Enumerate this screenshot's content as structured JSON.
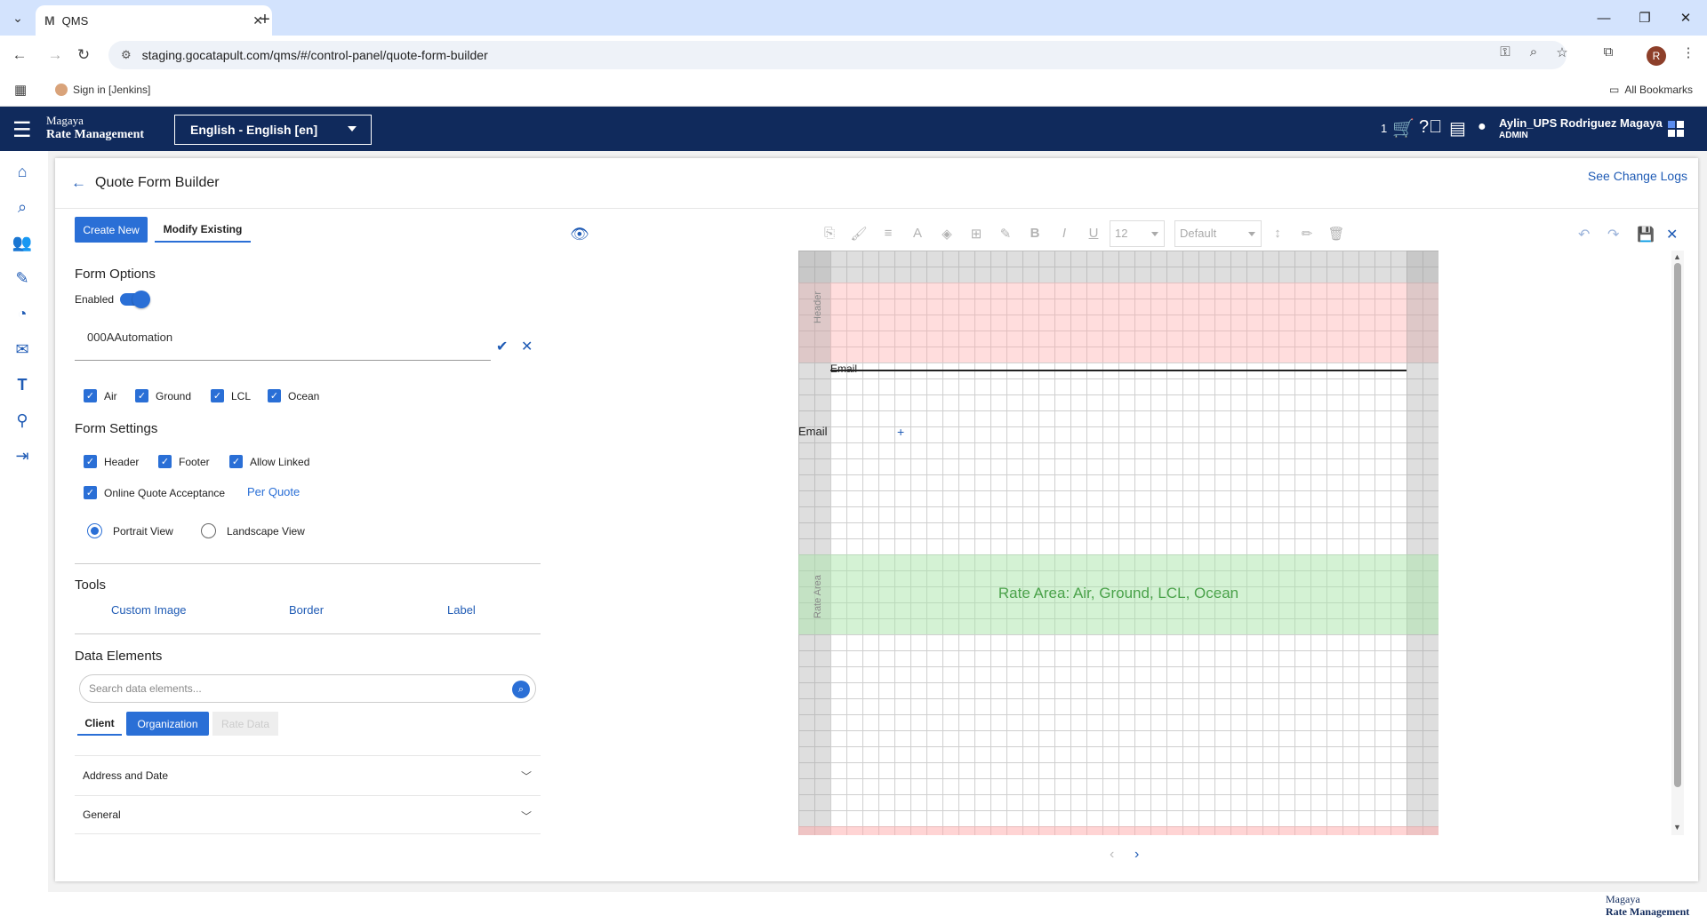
{
  "browser": {
    "tab_title": "QMS",
    "tab_favicon": "M",
    "url": "staging.gocatapult.com/qms/#/control-panel/quote-form-builder",
    "profile_initial": "R",
    "bookmark_jenkins": "Sign in [Jenkins]",
    "bookmark_all": "All Bookmarks"
  },
  "app": {
    "brand_line1": "Magaya",
    "brand_line2": "Rate Management",
    "language": "English - English [en]",
    "cart_count": "1",
    "user_name": "Aylin_UPS Rodriguez Magaya",
    "user_role": "ADMIN",
    "accent_color": "#2a6fd6",
    "header_color": "#102a5c"
  },
  "page": {
    "title": "Quote Form Builder",
    "change_logs": "See Change Logs"
  },
  "left_panel": {
    "create_new": "Create New",
    "modify_existing": "Modify Existing",
    "form_options_title": "Form Options",
    "enabled_label": "Enabled",
    "enabled": true,
    "form_name": "000AAutomation",
    "modes": [
      {
        "label": "Air",
        "checked": true
      },
      {
        "label": "Ground",
        "checked": true
      },
      {
        "label": "LCL",
        "checked": true
      },
      {
        "label": "Ocean",
        "checked": true
      }
    ],
    "form_settings_title": "Form Settings",
    "settings": [
      {
        "label": "Header",
        "checked": true
      },
      {
        "label": "Footer",
        "checked": true
      },
      {
        "label": "Allow Linked",
        "checked": true
      },
      {
        "label": "Online Quote Acceptance",
        "checked": true
      }
    ],
    "per_quote": "Per Quote",
    "portrait_view": "Portrait View",
    "landscape_view": "Landscape View",
    "orientation_selected": "Portrait View",
    "tools_title": "Tools",
    "tools": [
      "Custom Image",
      "Border",
      "Label"
    ],
    "data_elements_title": "Data Elements",
    "search_placeholder": "Search data elements...",
    "de_tabs": [
      "Client",
      "Organization",
      "Rate Data"
    ],
    "sections": [
      "Address and Date",
      "General"
    ]
  },
  "toolbar": {
    "font_size": "12",
    "font_family": "Default"
  },
  "canvas": {
    "header_label": "Header",
    "email_top": "Email",
    "email_left": "Email",
    "rate_area_label": "Rate Area",
    "rate_area_text": "Rate Area: Air, Ground, LCL, Ocean"
  },
  "footer": {
    "brand_line1": "Magaya",
    "brand_line2": "Rate Management"
  }
}
